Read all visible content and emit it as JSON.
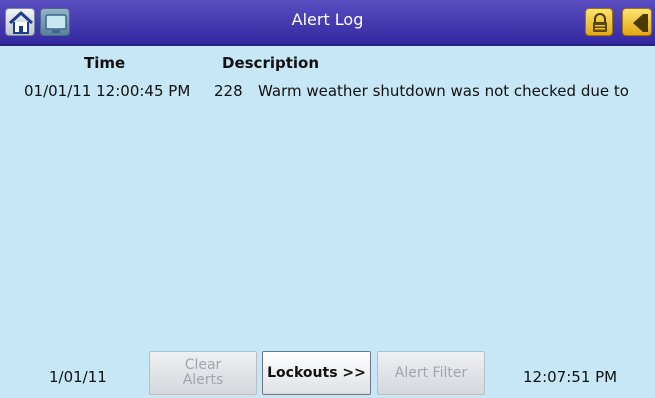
{
  "header": {
    "title": "Alert Log"
  },
  "table": {
    "columns": [
      "Time",
      "Description"
    ],
    "rows": [
      {
        "time": "01/01/11 12:00:45 PM",
        "code": "228",
        "description": "Warm weather shutdown was not checked due to"
      }
    ]
  },
  "footer": {
    "date": "1/01/11",
    "clear_alerts_label": "Clear Alerts",
    "lockouts_label": "Lockouts >>",
    "alert_filter_label": "Alert Filter",
    "time": "12:07:51 PM"
  },
  "icons": {
    "home": "home-icon",
    "screen": "screen-icon",
    "lock": "lock-icon",
    "back": "back-arrow-icon"
  },
  "colors": {
    "titlebar": "#3b30a8",
    "background": "#c7e7f6",
    "accent_yellow": "#f1c232"
  }
}
